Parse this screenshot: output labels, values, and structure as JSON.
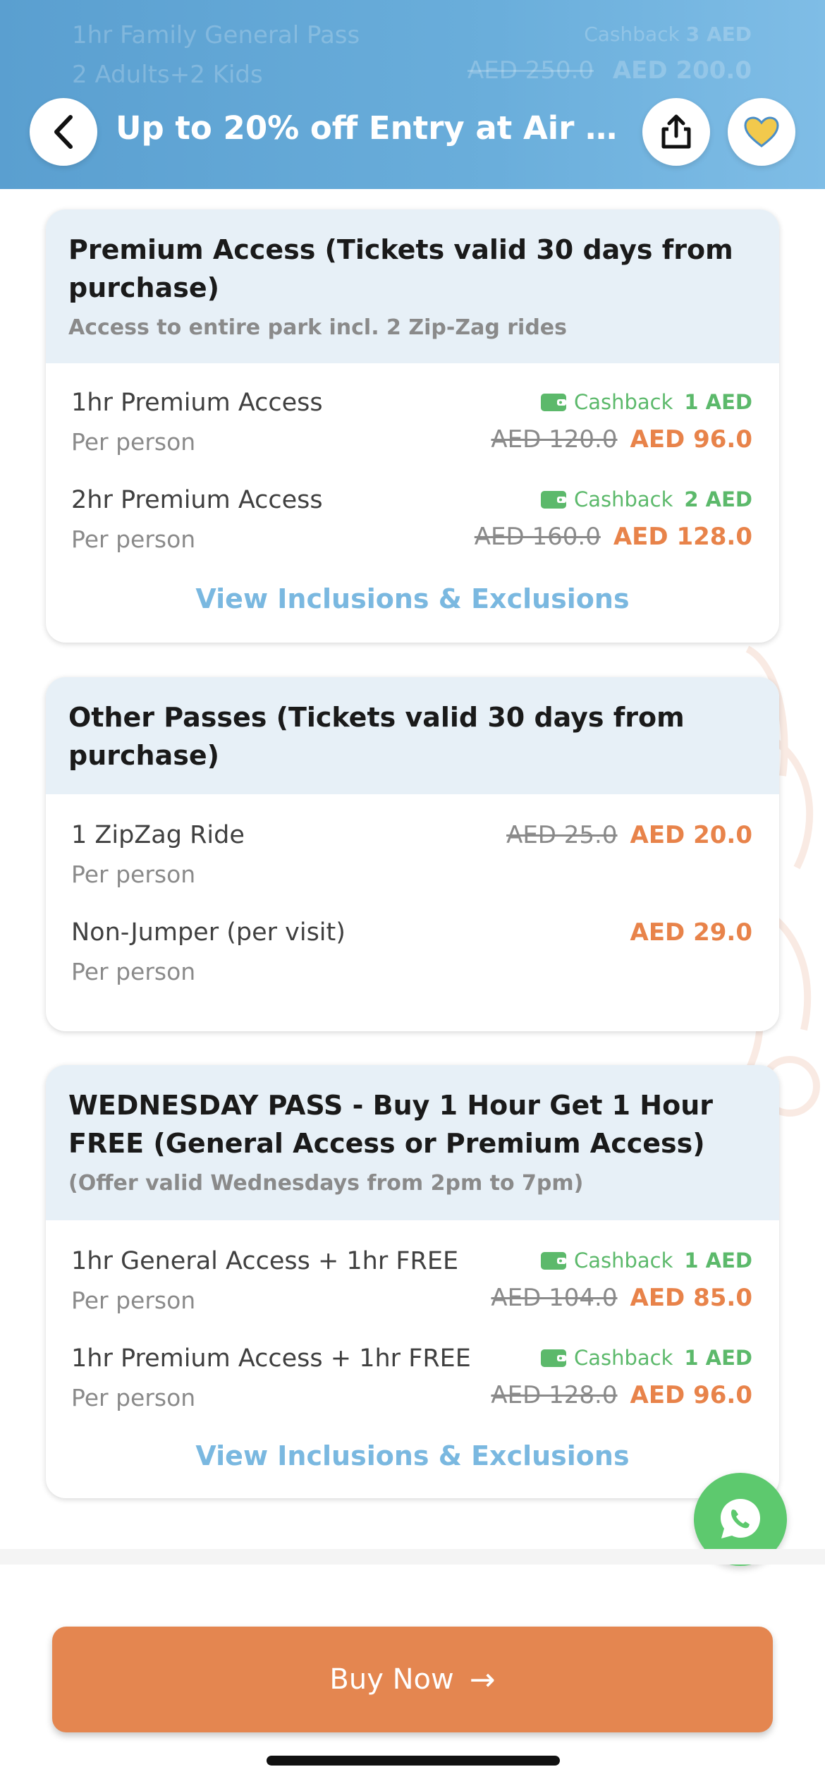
{
  "header": {
    "title": "Up to 20% off Entry at Air Mani...",
    "ghost": {
      "title": "1hr Family General Pass",
      "subtitle": "2 Adults+2 Kids",
      "cashback_label": "Cashback",
      "cashback_amount": "3 AED",
      "original_price": "AED 250.0",
      "price": "AED 200.0"
    },
    "icons": {
      "back": "chevron-left-icon",
      "share": "share-icon",
      "favorite": "heart-icon"
    }
  },
  "sections": [
    {
      "title": "Premium Access (Tickets valid 30 days from purchase)",
      "subtitle": "Access to entire park incl. 2 Zip-Zag rides",
      "items": [
        {
          "name": "1hr Premium Access",
          "per": "Per person",
          "cashback_label": "Cashback",
          "cashback_amount": "1 AED",
          "original_price": "AED 120.0",
          "price": "AED 96.0"
        },
        {
          "name": "2hr Premium Access",
          "per": "Per person",
          "cashback_label": "Cashback",
          "cashback_amount": "2 AED",
          "original_price": "AED 160.0",
          "price": "AED 128.0"
        }
      ],
      "link": "View Inclusions & Exclusions"
    },
    {
      "title": "Other Passes (Tickets valid 30 days from purchase)",
      "items": [
        {
          "name": "1 ZipZag Ride",
          "per": "Per person",
          "original_price": "AED 25.0",
          "price": "AED 20.0"
        },
        {
          "name": "Non-Jumper (per visit)",
          "per": "Per person",
          "price": "AED 29.0"
        }
      ]
    },
    {
      "title": "WEDNESDAY PASS - Buy 1 Hour Get 1 Hour FREE (General Access or Premium Access)",
      "subtitle": "(Offer valid Wednesdays from 2pm to 7pm)",
      "items": [
        {
          "name": "1hr General Access + 1hr FREE",
          "per": "Per person",
          "cashback_label": "Cashback",
          "cashback_amount": "1 AED",
          "original_price": "AED 104.0",
          "price": "AED 85.0"
        },
        {
          "name": "1hr Premium Access + 1hr FREE",
          "per": "Per person",
          "cashback_label": "Cashback",
          "cashback_amount": "1 AED",
          "original_price": "AED 128.0",
          "price": "AED 96.0"
        }
      ],
      "link": "View Inclusions & Exclusions"
    }
  ],
  "whatsapp": {
    "icon": "whatsapp-icon"
  },
  "footer": {
    "buy_label": "Buy Now",
    "buy_arrow": "→"
  },
  "colors": {
    "header": "#6aaedb",
    "accent_price": "#e8834a",
    "cashback": "#5cb96b",
    "link": "#7ab8e0",
    "buy_button": "#e48650",
    "whatsapp": "#5dc96e"
  }
}
